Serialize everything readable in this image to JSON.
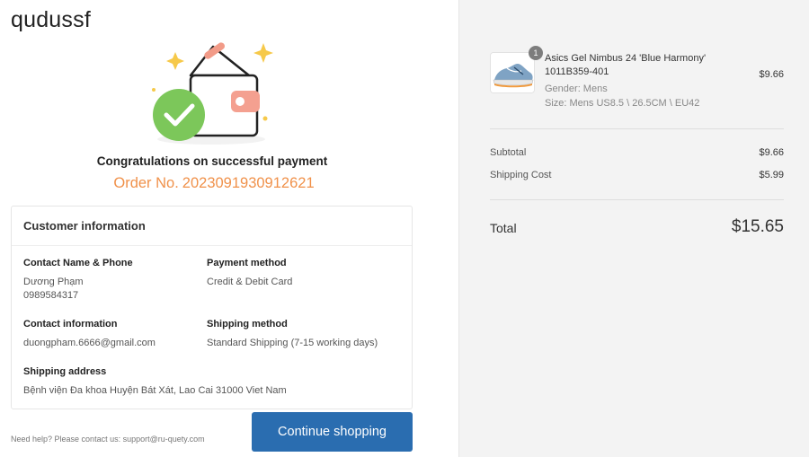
{
  "brand": "qudussf",
  "success": {
    "title": "Congratulations on successful payment",
    "order_label": "Order No.",
    "order_number": "2023091930912621"
  },
  "customer": {
    "heading": "Customer information",
    "contact_name_label": "Contact Name & Phone",
    "contact_name": "Dương Phạm",
    "contact_phone": "0989584317",
    "payment_label": "Payment method",
    "payment_value": "Credit & Debit Card",
    "contact_info_label": "Contact information",
    "contact_email": "duongpham.6666@gmail.com",
    "shipping_method_label": "Shipping method",
    "shipping_method_value": "Standard Shipping (7-15 working days)",
    "shipping_address_label": "Shipping address",
    "shipping_address_value": "Bệnh viện Đa khoa Huyện Bát Xát, Lao Cai 31000 Viet Nam"
  },
  "footer": {
    "help_text": "Need help? Please contact us: support@ru-quety.com",
    "continue_label": "Continue shopping"
  },
  "order_summary": {
    "item": {
      "quantity": "1",
      "name": "Asics Gel Nimbus 24 'Blue Harmony' 1011B359-401",
      "gender": "Gender: Mens",
      "size": "Size: Mens US8.5 \\ 26.5CM \\ EU42",
      "price": "$9.66"
    },
    "subtotal_label": "Subtotal",
    "subtotal_value": "$9.66",
    "shipping_label": "Shipping Cost",
    "shipping_value": "$5.99",
    "total_label": "Total",
    "total_value": "$15.65"
  },
  "colors": {
    "accent_orange": "#f0914a",
    "success_green": "#7cc75a",
    "button_blue": "#2a6db0"
  }
}
